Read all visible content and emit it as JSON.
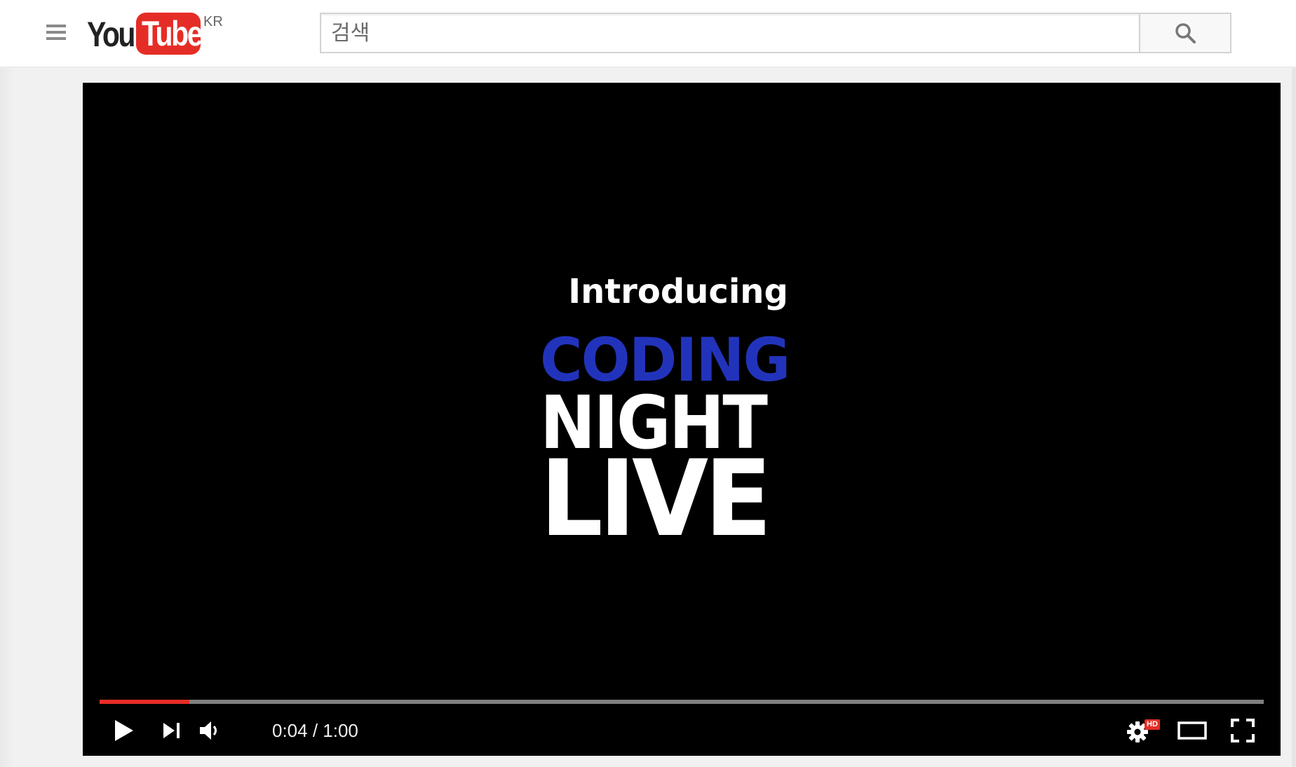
{
  "header": {
    "logo_you": "You",
    "logo_tube": "Tube",
    "region": "KR",
    "search": {
      "placeholder": "검색",
      "value": ""
    },
    "menu_icon": "hamburger-menu-icon",
    "search_icon": "magnifier-icon"
  },
  "video": {
    "frame_text": {
      "intro": "Introducing",
      "line1": "CODING",
      "line2": "NIGHT",
      "line3": "LIVE"
    },
    "colors": {
      "coding": "#2233bb",
      "progress_played": "#e52d27",
      "progress_track": "#7f7f7f"
    },
    "progress_fraction": 0.077,
    "time": {
      "current": "0:04",
      "separator": " / ",
      "duration": "1:00",
      "display": "0:04 / 1:00"
    },
    "controls": {
      "play_icon": "play-icon",
      "next_icon": "next-icon",
      "volume_icon": "volume-icon",
      "settings_icon": "gear-icon",
      "hd_badge": "HD",
      "theater_icon": "theater-mode-icon",
      "fullscreen_icon": "fullscreen-icon"
    }
  }
}
